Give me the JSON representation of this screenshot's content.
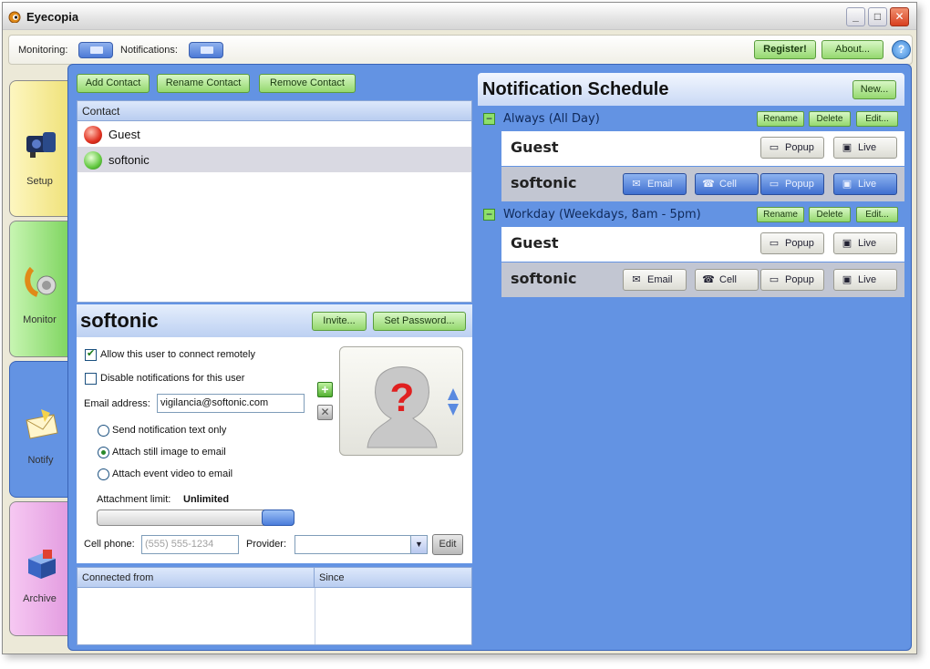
{
  "window": {
    "title": "Eyecopia",
    "controls": {
      "minimize": "_",
      "maximize": "□",
      "close": "✕"
    }
  },
  "toolbar": {
    "monitoring_label": "Monitoring:",
    "notifications_label": "Notifications:",
    "register_label": "Register!",
    "about_label": "About...",
    "help_label": "?"
  },
  "side_tabs": [
    {
      "label": "Setup",
      "icon": "camera-icon",
      "color": "#f6ea8f"
    },
    {
      "label": "Monitor",
      "icon": "monitor-eye-icon",
      "color": "#8ede70"
    },
    {
      "label": "Notify",
      "icon": "envelope-icon",
      "color": "#6393e3"
    },
    {
      "label": "Archive",
      "icon": "archive-box-icon",
      "color": "#e7a0e2"
    }
  ],
  "contacts": {
    "add_label": "Add Contact",
    "rename_label": "Rename Contact",
    "remove_label": "Remove Contact",
    "column_header": "Contact",
    "items": [
      {
        "name": "Guest",
        "status": "red"
      },
      {
        "name": "softonic",
        "status": "green"
      }
    ]
  },
  "detail": {
    "name": "softonic",
    "invite_label": "Invite...",
    "set_password_label": "Set Password...",
    "allow_remote_label": "Allow this user to connect remotely",
    "allow_remote_checked": true,
    "disable_notifications_label": "Disable notifications for this user",
    "disable_notifications_checked": false,
    "email_label": "Email address:",
    "email_value": "vigilancia@softonic.com",
    "radio_options": [
      "Send notification text only",
      "Attach still image to email",
      "Attach event video to email"
    ],
    "radio_selected": 1,
    "attachment_limit_label": "Attachment limit:",
    "attachment_limit_value": "Unlimited",
    "cell_label": "Cell phone:",
    "cell_placeholder": "(555) 555-1234",
    "provider_label": "Provider:",
    "provider_value": "",
    "edit_label": "Edit",
    "photo_placeholder": "?"
  },
  "connections": {
    "col1": "Connected from",
    "col2": "Since"
  },
  "schedule": {
    "title": "Notification Schedule",
    "new_label": "New...",
    "rename_label": "Rename",
    "delete_label": "Delete",
    "edit_label": "Edit...",
    "collapse": "−",
    "groups": [
      {
        "label": "Always (All Day)",
        "rows": [
          {
            "name": "Guest",
            "buttons": [
              {
                "label": "Popup",
                "on": false
              },
              {
                "label": "Live",
                "on": false
              }
            ]
          },
          {
            "name": "softonic",
            "buttons": [
              {
                "label": "Email",
                "on": true
              },
              {
                "label": "Cell",
                "on": true
              },
              {
                "label": "Popup",
                "on": true
              },
              {
                "label": "Live",
                "on": true
              }
            ]
          }
        ]
      },
      {
        "label": "Workday (Weekdays, 8am - 5pm)",
        "rows": [
          {
            "name": "Guest",
            "buttons": [
              {
                "label": "Popup",
                "on": false
              },
              {
                "label": "Live",
                "on": false
              }
            ]
          },
          {
            "name": "softonic",
            "buttons": [
              {
                "label": "Email",
                "on": false
              },
              {
                "label": "Cell",
                "on": false
              },
              {
                "label": "Popup",
                "on": false
              },
              {
                "label": "Live",
                "on": false
              }
            ]
          }
        ]
      }
    ]
  }
}
